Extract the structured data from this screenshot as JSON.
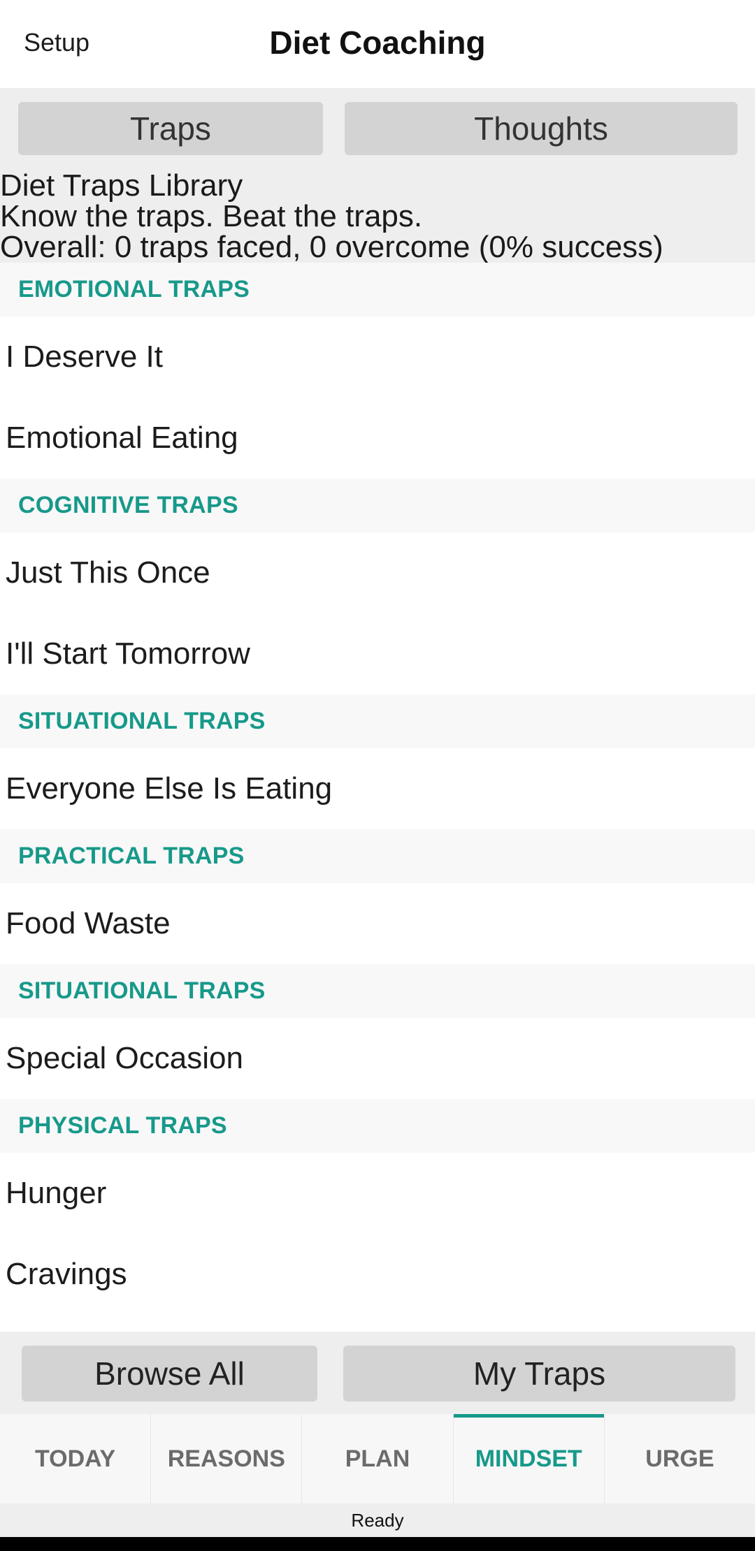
{
  "header": {
    "setup_label": "Setup",
    "title": "Diet Coaching"
  },
  "segments": {
    "traps_label": "Traps",
    "thoughts_label": "Thoughts"
  },
  "library": {
    "title": "Diet Traps Library",
    "subtitle": "Know the traps. Beat the traps.",
    "stats": "Overall: 0 traps faced, 0 overcome (0% success)"
  },
  "sections": [
    {
      "header": "EMOTIONAL TRAPS",
      "items": [
        "I Deserve It",
        "Emotional Eating"
      ]
    },
    {
      "header": "COGNITIVE TRAPS",
      "items": [
        "Just This Once",
        "I'll Start Tomorrow"
      ]
    },
    {
      "header": "SITUATIONAL TRAPS",
      "items": [
        "Everyone Else Is Eating"
      ]
    },
    {
      "header": "PRACTICAL TRAPS",
      "items": [
        "Food Waste"
      ]
    },
    {
      "header": "SITUATIONAL TRAPS",
      "items": [
        "Special Occasion"
      ]
    },
    {
      "header": "PHYSICAL TRAPS",
      "items": [
        "Hunger",
        "Cravings"
      ]
    }
  ],
  "bottom_buttons": {
    "browse_all": "Browse All",
    "my_traps": "My Traps"
  },
  "tabs": [
    {
      "label": "TODAY",
      "active": false
    },
    {
      "label": "REASONS",
      "active": false
    },
    {
      "label": "PLAN",
      "active": false
    },
    {
      "label": "MINDSET",
      "active": true
    },
    {
      "label": "URGE",
      "active": false
    }
  ],
  "status": "Ready",
  "colors": {
    "accent": "#17998a",
    "button_bg": "#d3d3d3",
    "panel_bg": "#eeeeee"
  }
}
